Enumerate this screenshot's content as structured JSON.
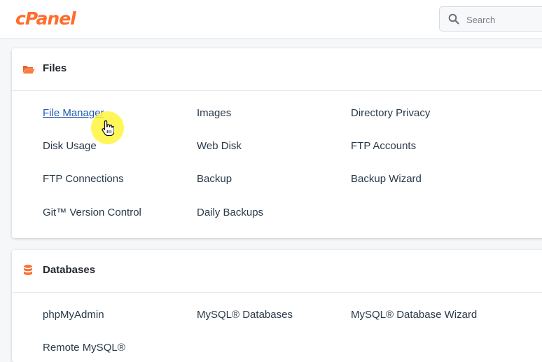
{
  "header": {
    "logo_text": "cPanel",
    "search": {
      "placeholder": "Search",
      "value": ""
    }
  },
  "sections": [
    {
      "title": "Files",
      "icon": "folder-open-icon",
      "items": [
        "File Manager",
        "Images",
        "Directory Privacy",
        "Disk Usage",
        "Web Disk",
        "FTP Accounts",
        "FTP Connections",
        "Backup",
        "Backup Wizard",
        "Git™ Version Control",
        "Daily Backups"
      ]
    },
    {
      "title": "Databases",
      "icon": "database-icon",
      "items": [
        "phpMyAdmin",
        "MySQL® Databases",
        "MySQL® Database Wizard",
        "Remote MySQL®"
      ]
    }
  ],
  "cursor": {
    "type": "hand-pointer-icon",
    "hovering": "File Manager"
  },
  "colors": {
    "brand": "#ff6c2c",
    "link": "#293a4a",
    "link_hover": "#1f57b0",
    "cursor_highlight": "#fff53c"
  }
}
